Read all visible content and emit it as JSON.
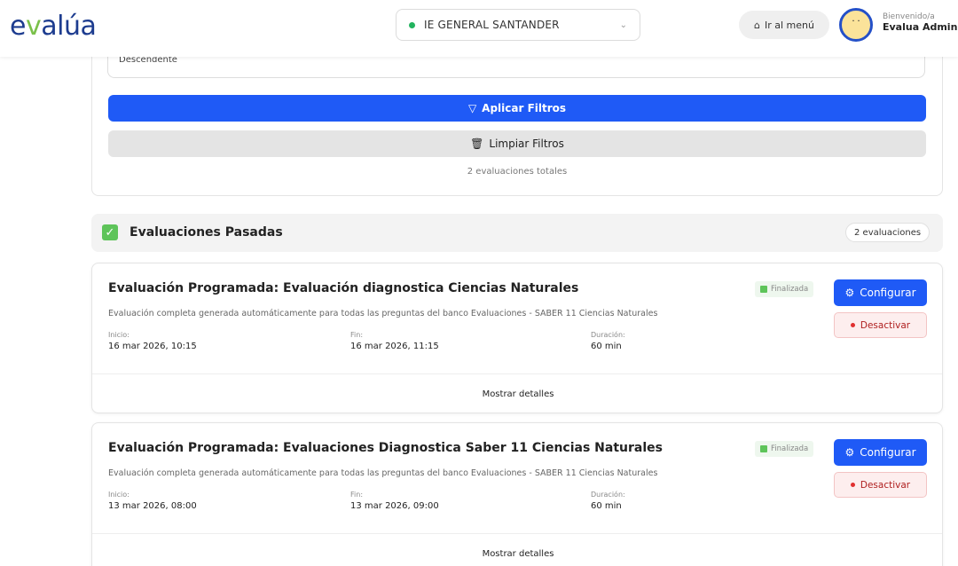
{
  "header": {
    "logo_text": "evalúa",
    "school": "IE GENERAL SANTANDER",
    "menu_label": "Ir al menú",
    "welcome_small": "Bienvenido/a",
    "welcome_name": "Evalua Administrador"
  },
  "filters": {
    "order_value": "Descendente",
    "apply_label": "Aplicar Filtros",
    "clear_label": "Limpiar Filtros",
    "total_text": "2 evaluaciones totales"
  },
  "past": {
    "title": "Evaluaciones Pasadas",
    "count": "2 evaluaciones"
  },
  "evaluations": [
    {
      "title": "Evaluación Programada: Evaluación diagnostica Ciencias Naturales",
      "description": "Evaluación completa generada automáticamente para todas las preguntas del banco Evaluaciones - SABER 11 Ciencias Naturales",
      "start_label": "Inicio:",
      "start": "16 mar 2026, 10:15",
      "end_label": "Fin:",
      "end": "16 mar 2026, 11:15",
      "duration_label": "Duración:",
      "duration": "60 min",
      "status": "Finalizada",
      "config_label": "Configurar",
      "deactivate_label": "Desactivar",
      "details_label": "Mostrar detalles"
    },
    {
      "title": "Evaluación Programada: Evaluaciones Diagnostica Saber 11 Ciencias Naturales",
      "description": "Evaluación completa generada automáticamente para todas las preguntas del banco Evaluaciones - SABER 11 Ciencias Naturales",
      "start_label": "Inicio:",
      "start": "13 mar 2026, 08:00",
      "end_label": "Fin:",
      "end": "13 mar 2026, 09:00",
      "duration_label": "Duración:",
      "duration": "60 min",
      "status": "Finalizada",
      "config_label": "Configurar",
      "deactivate_label": "Desactivar",
      "details_label": "Mostrar detalles"
    }
  ],
  "colors": {
    "primary": "#1f5af6",
    "brand_navy": "#1d3c8f",
    "brand_green": "#7ac04a",
    "success": "#5ec45a",
    "danger": "#e03030"
  },
  "icons": {
    "apply": "filter-icon",
    "clear": "trash-icon",
    "menu": "home-icon",
    "config": "gear-icon",
    "section": "checkbox-icon"
  }
}
